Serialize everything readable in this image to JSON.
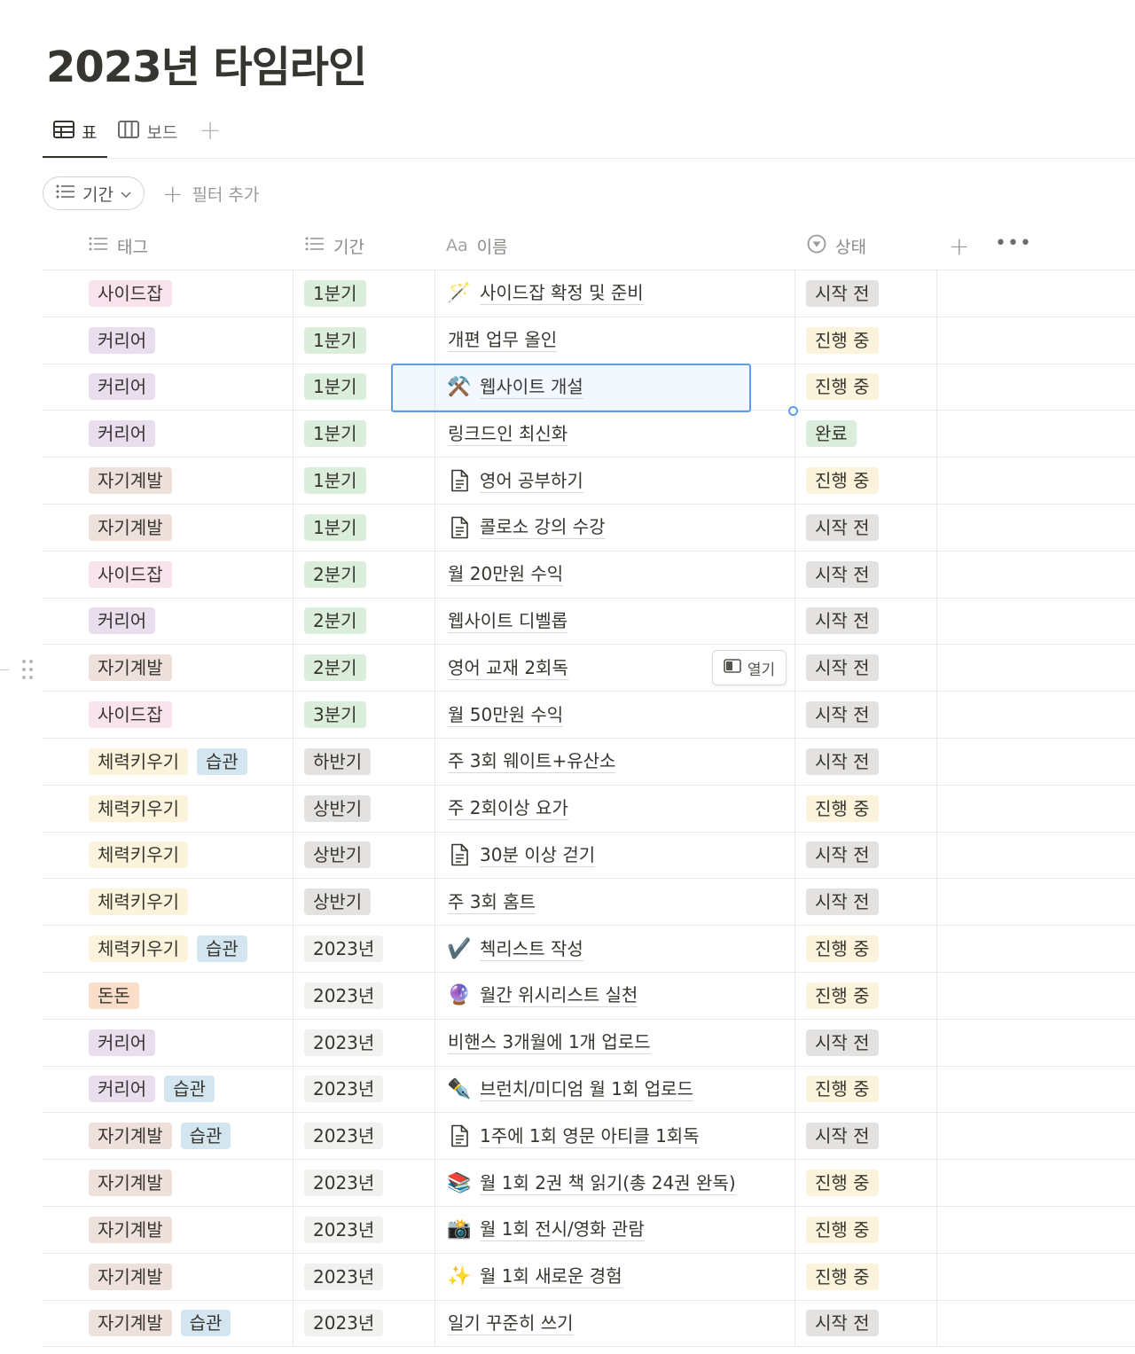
{
  "page": {
    "title": "2023년 타임라인"
  },
  "views": {
    "tabs": [
      {
        "label": "표",
        "icon": "table-icon"
      },
      {
        "label": "보드",
        "icon": "board-icon"
      }
    ],
    "add_icon": "plus-icon"
  },
  "filters": {
    "sort_pill": "기간",
    "add_filter": "필터 추가"
  },
  "table": {
    "headers": {
      "tags": "태그",
      "period": "기간",
      "name_prefix": "Aa",
      "name": "이름",
      "status": "상태"
    },
    "open_button": "열기",
    "rows": [
      {
        "tags": [
          {
            "label": "사이드잡",
            "color": "#f9e3ec"
          }
        ],
        "period": {
          "label": "1분기",
          "color": "#dbeddb"
        },
        "icon": "🪄",
        "name": "사이드잡 확정 및 준비",
        "status": {
          "label": "시작 전",
          "color": "#e3e2e0"
        }
      },
      {
        "tags": [
          {
            "label": "커리어",
            "color": "#e8deee"
          }
        ],
        "period": {
          "label": "1분기",
          "color": "#dbeddb"
        },
        "icon": "",
        "name": "개편 업무 올인",
        "status": {
          "label": "진행 중",
          "color": "#fbf3db"
        }
      },
      {
        "tags": [
          {
            "label": "커리어",
            "color": "#e8deee"
          }
        ],
        "period": {
          "label": "1분기",
          "color": "#dbeddb"
        },
        "icon": "⚒️",
        "name": "웹사이트 개설",
        "status": {
          "label": "진행 중",
          "color": "#fbf3db"
        }
      },
      {
        "tags": [
          {
            "label": "커리어",
            "color": "#e8deee"
          }
        ],
        "period": {
          "label": "1분기",
          "color": "#dbeddb"
        },
        "icon": "",
        "name": "링크드인 최신화",
        "status": {
          "label": "완료",
          "color": "#dbeddb"
        }
      },
      {
        "tags": [
          {
            "label": "자기계발",
            "color": "#eee0da"
          }
        ],
        "period": {
          "label": "1분기",
          "color": "#dbeddb"
        },
        "icon": "page",
        "name": "영어 공부하기",
        "status": {
          "label": "진행 중",
          "color": "#fbf3db"
        }
      },
      {
        "tags": [
          {
            "label": "자기계발",
            "color": "#eee0da"
          }
        ],
        "period": {
          "label": "1분기",
          "color": "#dbeddb"
        },
        "icon": "page",
        "name": "콜로소 강의 수강",
        "status": {
          "label": "시작 전",
          "color": "#e3e2e0"
        }
      },
      {
        "tags": [
          {
            "label": "사이드잡",
            "color": "#f9e3ec"
          }
        ],
        "period": {
          "label": "2분기",
          "color": "#dbeddb"
        },
        "icon": "",
        "name": "월 20만원 수익",
        "status": {
          "label": "시작 전",
          "color": "#e3e2e0"
        }
      },
      {
        "tags": [
          {
            "label": "커리어",
            "color": "#e8deee"
          }
        ],
        "period": {
          "label": "2분기",
          "color": "#dbeddb"
        },
        "icon": "",
        "name": "웹사이트 디벨롭",
        "status": {
          "label": "시작 전",
          "color": "#e3e2e0"
        }
      },
      {
        "tags": [
          {
            "label": "자기계발",
            "color": "#eee0da"
          }
        ],
        "period": {
          "label": "2분기",
          "color": "#dbeddb"
        },
        "icon": "",
        "name": "영어 교재 2회독",
        "status": {
          "label": "시작 전",
          "color": "#e3e2e0"
        }
      },
      {
        "tags": [
          {
            "label": "사이드잡",
            "color": "#f9e3ec"
          }
        ],
        "period": {
          "label": "3분기",
          "color": "#dbeddb"
        },
        "icon": "",
        "name": "월 50만원 수익",
        "status": {
          "label": "시작 전",
          "color": "#e3e2e0"
        }
      },
      {
        "tags": [
          {
            "label": "체력키우기",
            "color": "#fbf3db"
          },
          {
            "label": "습관",
            "color": "#d3e5ef"
          }
        ],
        "period": {
          "label": "하반기",
          "color": "#e3e2e0"
        },
        "icon": "",
        "name": "주 3회 웨이트+유산소",
        "status": {
          "label": "시작 전",
          "color": "#e3e2e0"
        }
      },
      {
        "tags": [
          {
            "label": "체력키우기",
            "color": "#fbf3db"
          }
        ],
        "period": {
          "label": "상반기",
          "color": "#e3e2e0"
        },
        "icon": "",
        "name": "주 2회이상 요가",
        "status": {
          "label": "진행 중",
          "color": "#fbf3db"
        }
      },
      {
        "tags": [
          {
            "label": "체력키우기",
            "color": "#fbf3db"
          }
        ],
        "period": {
          "label": "상반기",
          "color": "#e3e2e0"
        },
        "icon": "page",
        "name": "30분 이상 걷기",
        "status": {
          "label": "시작 전",
          "color": "#e3e2e0"
        }
      },
      {
        "tags": [
          {
            "label": "체력키우기",
            "color": "#fbf3db"
          }
        ],
        "period": {
          "label": "상반기",
          "color": "#e3e2e0"
        },
        "icon": "",
        "name": "주 3회 홈트",
        "status": {
          "label": "시작 전",
          "color": "#e3e2e0"
        }
      },
      {
        "tags": [
          {
            "label": "체력키우기",
            "color": "#fbf3db"
          },
          {
            "label": "습관",
            "color": "#d3e5ef"
          }
        ],
        "period": {
          "label": "2023년",
          "color": "#f1f1ef"
        },
        "icon": "✔️",
        "name": "첵리스트 작성",
        "status": {
          "label": "진행 중",
          "color": "#fbf3db"
        }
      },
      {
        "tags": [
          {
            "label": "돈돈",
            "color": "#fadec9"
          }
        ],
        "period": {
          "label": "2023년",
          "color": "#f1f1ef"
        },
        "icon": "🔮",
        "name": "월간 위시리스트 실천",
        "status": {
          "label": "진행 중",
          "color": "#fbf3db"
        }
      },
      {
        "tags": [
          {
            "label": "커리어",
            "color": "#e8deee"
          }
        ],
        "period": {
          "label": "2023년",
          "color": "#f1f1ef"
        },
        "icon": "",
        "name": "비핸스 3개월에 1개 업로드",
        "status": {
          "label": "시작 전",
          "color": "#e3e2e0"
        }
      },
      {
        "tags": [
          {
            "label": "커리어",
            "color": "#e8deee"
          },
          {
            "label": "습관",
            "color": "#d3e5ef"
          }
        ],
        "period": {
          "label": "2023년",
          "color": "#f1f1ef"
        },
        "icon": "✒️",
        "name": "브런치/미디엄 월 1회 업로드",
        "status": {
          "label": "진행 중",
          "color": "#fbf3db"
        }
      },
      {
        "tags": [
          {
            "label": "자기계발",
            "color": "#eee0da"
          },
          {
            "label": "습관",
            "color": "#d3e5ef"
          }
        ],
        "period": {
          "label": "2023년",
          "color": "#f1f1ef"
        },
        "icon": "page",
        "name": "1주에 1회 영문 아티클 1회독",
        "status": {
          "label": "시작 전",
          "color": "#e3e2e0"
        }
      },
      {
        "tags": [
          {
            "label": "자기계발",
            "color": "#eee0da"
          }
        ],
        "period": {
          "label": "2023년",
          "color": "#f1f1ef"
        },
        "icon": "📚",
        "name": "월 1회 2권 책 읽기(총 24권 완독)",
        "status": {
          "label": "진행 중",
          "color": "#fbf3db"
        }
      },
      {
        "tags": [
          {
            "label": "자기계발",
            "color": "#eee0da"
          }
        ],
        "period": {
          "label": "2023년",
          "color": "#f1f1ef"
        },
        "icon": "📸",
        "name": "월 1회 전시/영화 관람",
        "status": {
          "label": "진행 중",
          "color": "#fbf3db"
        }
      },
      {
        "tags": [
          {
            "label": "자기계발",
            "color": "#eee0da"
          }
        ],
        "period": {
          "label": "2023년",
          "color": "#f1f1ef"
        },
        "icon": "✨",
        "name": "월 1회 새로운 경험",
        "status": {
          "label": "진행 중",
          "color": "#fbf3db"
        }
      },
      {
        "tags": [
          {
            "label": "자기계발",
            "color": "#eee0da"
          },
          {
            "label": "습관",
            "color": "#d3e5ef"
          }
        ],
        "period": {
          "label": "2023년",
          "color": "#f1f1ef"
        },
        "icon": "",
        "name": "일기 꾸준히 쓰기",
        "status": {
          "label": "시작 전",
          "color": "#e3e2e0"
        }
      }
    ]
  }
}
